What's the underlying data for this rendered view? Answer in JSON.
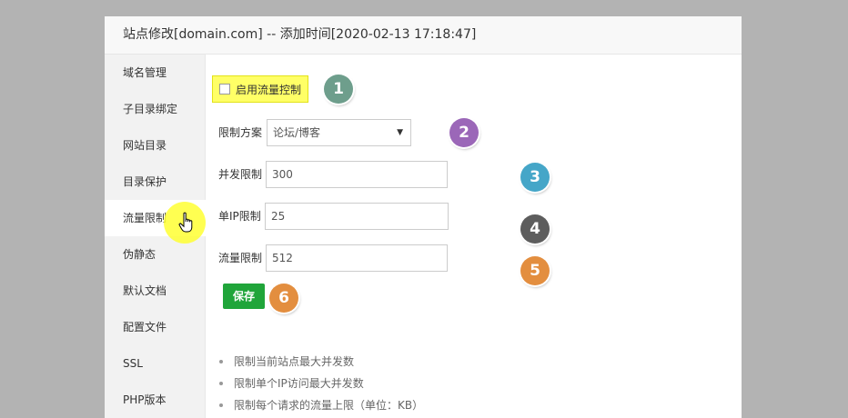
{
  "title": "站点修改[domain.com] -- 添加时间[2020-02-13 17:18:47]",
  "sidebar": {
    "items": [
      {
        "label": "域名管理"
      },
      {
        "label": "子目录绑定"
      },
      {
        "label": "网站目录"
      },
      {
        "label": "目录保护"
      },
      {
        "label": "流量限制"
      },
      {
        "label": "伪静态"
      },
      {
        "label": "默认文档"
      },
      {
        "label": "配置文件"
      },
      {
        "label": "SSL"
      },
      {
        "label": "PHP版本"
      }
    ]
  },
  "form": {
    "enable_label": "启用流量控制",
    "enable_checked": false,
    "scheme_label": "限制方案",
    "scheme_value": "论坛/博客",
    "concurrent_label": "并发限制",
    "concurrent_value": "300",
    "per_ip_label": "单IP限制",
    "per_ip_value": "25",
    "traffic_label": "流量限制",
    "traffic_value": "512",
    "save_label": "保存"
  },
  "help": [
    "限制当前站点最大并发数",
    "限制单个IP访问最大并发数",
    "限制每个请求的流量上限（单位：KB）"
  ],
  "badges": [
    {
      "num": "1",
      "color": "#6e9e8c"
    },
    {
      "num": "2",
      "color": "#9b67b8"
    },
    {
      "num": "3",
      "color": "#45a6c8"
    },
    {
      "num": "4",
      "color": "#5d5d5d"
    },
    {
      "num": "5",
      "color": "#e38e3f"
    },
    {
      "num": "6",
      "color": "#e38e3f"
    }
  ],
  "colors": {
    "accent": "#20a53a",
    "highlight": "#ffff66"
  }
}
